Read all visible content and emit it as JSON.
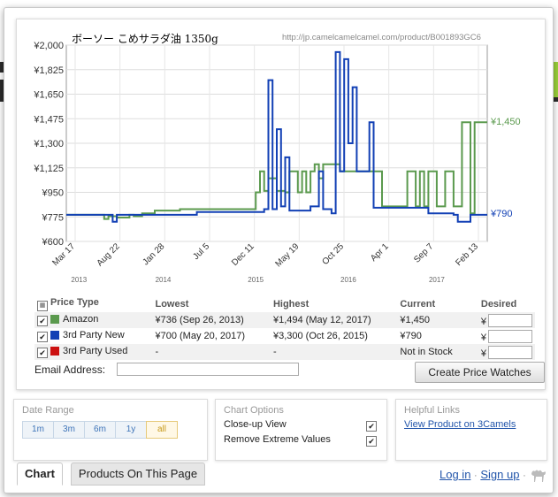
{
  "chart": {
    "title": "ボーソー こめサラダ油 1350g",
    "url": "http://jp.camelcamelcamel.com/product/B001893GC6",
    "current_amazon_label": "¥1,450",
    "current_3p_label": "¥790"
  },
  "chart_data": {
    "type": "line",
    "title": "ボーソー こめサラダ油 1350g",
    "ylim": [
      600,
      2000
    ],
    "y_ticks": [
      "¥2,000",
      "¥1,825",
      "¥1,650",
      "¥1,475",
      "¥1,300",
      "¥1,125",
      "¥950",
      "¥775",
      "¥600"
    ],
    "x_ticks": [
      "Mar 17",
      "Aug 22",
      "Jan 28",
      "Jul 5",
      "Dec 11",
      "May 19",
      "Oct 25",
      "Apr 1",
      "Sep 7",
      "Feb 13"
    ],
    "year_labels": [
      "2013",
      "2014",
      "2015",
      "2016",
      "2017"
    ],
    "series": [
      {
        "name": "Amazon",
        "color": "#5b9a4e",
        "points": [
          [
            0,
            790
          ],
          [
            0.08,
            790
          ],
          [
            0.09,
            760
          ],
          [
            0.1,
            780
          ],
          [
            0.12,
            770
          ],
          [
            0.15,
            790
          ],
          [
            0.16,
            780
          ],
          [
            0.18,
            800
          ],
          [
            0.2,
            800
          ],
          [
            0.21,
            820
          ],
          [
            0.27,
            830
          ],
          [
            0.4,
            830
          ],
          [
            0.44,
            830
          ],
          [
            0.45,
            950
          ],
          [
            0.46,
            1100
          ],
          [
            0.47,
            960
          ],
          [
            0.48,
            1050
          ],
          [
            0.5,
            960
          ],
          [
            0.52,
            950
          ],
          [
            0.53,
            1100
          ],
          [
            0.55,
            950
          ],
          [
            0.56,
            1100
          ],
          [
            0.57,
            950
          ],
          [
            0.58,
            1100
          ],
          [
            0.59,
            1150
          ],
          [
            0.6,
            1050
          ],
          [
            0.61,
            1150
          ],
          [
            0.65,
            1100
          ],
          [
            0.74,
            1100
          ],
          [
            0.75,
            850
          ],
          [
            0.8,
            850
          ],
          [
            0.81,
            1100
          ],
          [
            0.83,
            850
          ],
          [
            0.84,
            1100
          ],
          [
            0.85,
            850
          ],
          [
            0.86,
            1100
          ],
          [
            0.88,
            850
          ],
          [
            0.9,
            1100
          ],
          [
            0.92,
            850
          ],
          [
            0.94,
            1450
          ],
          [
            0.96,
            800
          ],
          [
            0.97,
            1450
          ],
          [
            1.0,
            1450
          ]
        ]
      },
      {
        "name": "3rd Party New",
        "color": "#1240b5",
        "points": [
          [
            0,
            790
          ],
          [
            0.1,
            790
          ],
          [
            0.11,
            740
          ],
          [
            0.12,
            790
          ],
          [
            0.3,
            790
          ],
          [
            0.31,
            810
          ],
          [
            0.44,
            810
          ],
          [
            0.47,
            830
          ],
          [
            0.48,
            1750
          ],
          [
            0.49,
            830
          ],
          [
            0.5,
            1400
          ],
          [
            0.51,
            850
          ],
          [
            0.52,
            1200
          ],
          [
            0.53,
            820
          ],
          [
            0.56,
            820
          ],
          [
            0.58,
            850
          ],
          [
            0.6,
            1100
          ],
          [
            0.61,
            830
          ],
          [
            0.63,
            800
          ],
          [
            0.64,
            1950
          ],
          [
            0.65,
            1100
          ],
          [
            0.66,
            1900
          ],
          [
            0.67,
            1300
          ],
          [
            0.68,
            1700
          ],
          [
            0.69,
            1100
          ],
          [
            0.7,
            1100
          ],
          [
            0.72,
            1450
          ],
          [
            0.73,
            840
          ],
          [
            0.8,
            840
          ],
          [
            0.85,
            840
          ],
          [
            0.86,
            800
          ],
          [
            0.9,
            800
          ],
          [
            0.92,
            790
          ],
          [
            0.93,
            740
          ],
          [
            0.96,
            790
          ],
          [
            1.0,
            790
          ]
        ]
      },
      {
        "name": "3rd Party Used",
        "color": "#cc1111",
        "points": []
      }
    ]
  },
  "table": {
    "headers": [
      "Price Type",
      "Lowest",
      "Highest",
      "Current",
      "Desired"
    ],
    "currency_symbol": "¥",
    "rows": [
      {
        "name": "Amazon",
        "color": "#5b9a4e",
        "lowest": "¥736 (Sep 26, 2013)",
        "highest": "¥1,494 (May 12, 2017)",
        "current": "¥1,450"
      },
      {
        "name": "3rd Party New",
        "color": "#1240b5",
        "lowest": "¥700 (May 20, 2017)",
        "highest": "¥3,300 (Oct 26, 2015)",
        "current": "¥790"
      },
      {
        "name": "3rd Party Used",
        "color": "#cc1111",
        "lowest": "-",
        "highest": "-",
        "current": "Not in Stock"
      }
    ]
  },
  "email": {
    "label": "Email Address:"
  },
  "create_button": "Create Price Watches",
  "date_range": {
    "title": "Date Range",
    "options": [
      "1m",
      "3m",
      "6m",
      "1y",
      "all"
    ],
    "active": "all"
  },
  "chart_options": {
    "title": "Chart Options",
    "closeup_label": "Close-up View",
    "remove_extreme_label": "Remove Extreme Values",
    "closeup_checked": true,
    "remove_extreme_checked": true
  },
  "helpful_links": {
    "title": "Helpful Links",
    "link": "View Product on 3Camels"
  },
  "tabs": {
    "chart": "Chart",
    "products": "Products On This Page"
  },
  "footer": {
    "login": "Log in",
    "sep": "·",
    "signup": "Sign up",
    "sep2": "·"
  },
  "colors": {
    "amazon": "#5b9a4e",
    "third_new": "#1240b5",
    "third_used": "#cc1111",
    "accent": "#2255aa"
  },
  "icons": {
    "camel": "camel-icon",
    "check": "checkmark-icon"
  }
}
